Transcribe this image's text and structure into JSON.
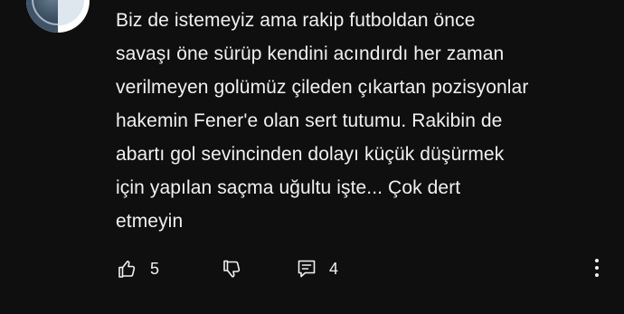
{
  "comment": {
    "text": "Biz de istemeyiz ama rakip futboldan önce\nsavaşı öne sürüp kendini acındırdı her zaman\nverilmeyen golümüz çileden çıkartan pozisyonlar\nhakemin Fener'e olan sert tutumu. Rakibin de\nabartı gol sevincinden dolayı küçük düşürmek\niçin yapılan saçma uğultu işte... Çok dert\netmeyin"
  },
  "actions": {
    "like_count": "5",
    "reply_count": "4"
  },
  "icons": {
    "like": "thumbs-up-icon",
    "dislike": "thumbs-down-icon",
    "replies": "comment-icon",
    "more": "more-vertical-icon"
  },
  "colors": {
    "background": "#0f0f0f",
    "text": "#f1f1f1"
  }
}
